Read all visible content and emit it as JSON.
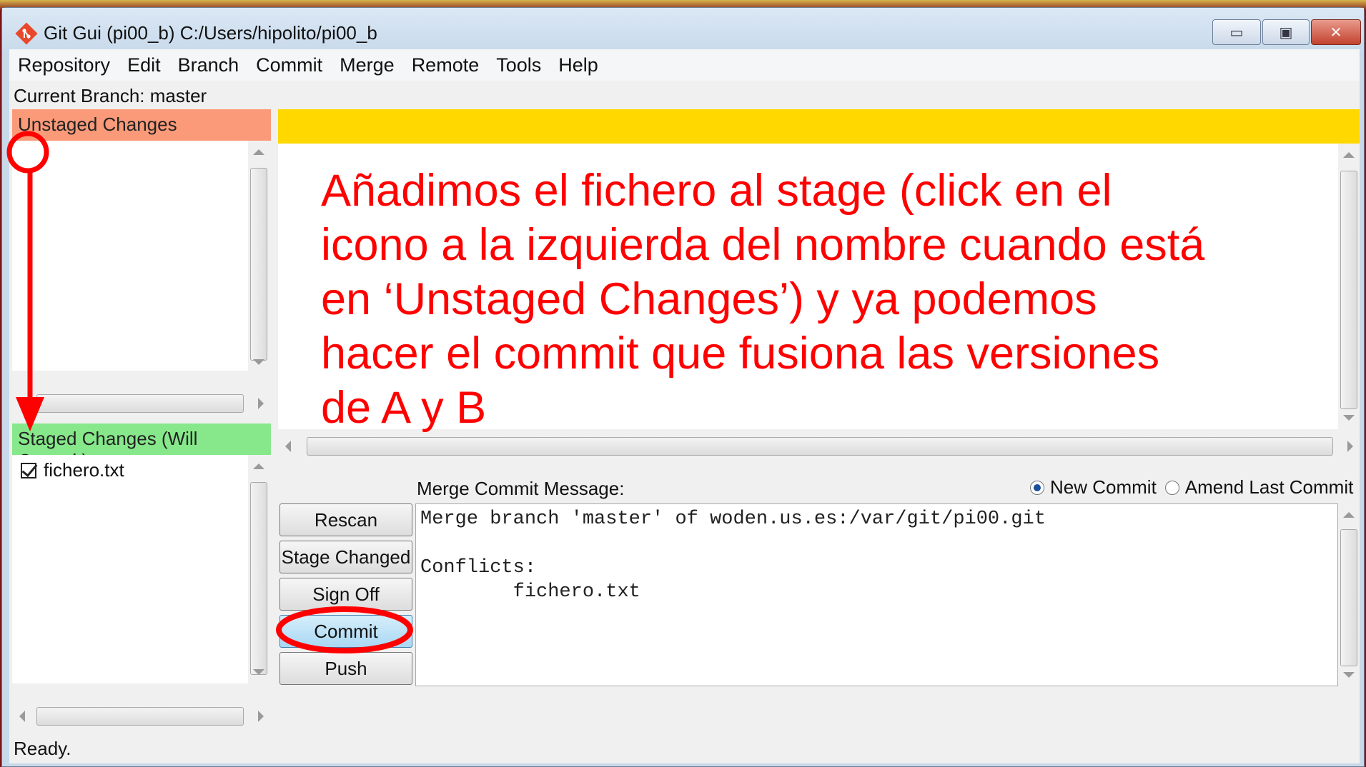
{
  "window": {
    "title": "Git Gui (pi00_b) C:/Users/hipolito/pi00_b",
    "minimize_glyph": "▭",
    "maximize_glyph": "▣",
    "close_glyph": "✕"
  },
  "menu": [
    "Repository",
    "Edit",
    "Branch",
    "Commit",
    "Merge",
    "Remote",
    "Tools",
    "Help"
  ],
  "branch_line": "Current Branch: master",
  "unstaged": {
    "header": "Unstaged Changes"
  },
  "staged": {
    "header": "Staged Changes (Will Commit)",
    "files": [
      "fichero.txt"
    ]
  },
  "annotation": "Añadimos el fichero al stage (click en el icono a la izquierda del nombre cuando está en ‘Unstaged Changes’) y ya podemos hacer el commit que fusiona las versiones de A y B",
  "commit": {
    "label": "Merge Commit Message:",
    "radio_new": "New Commit",
    "radio_amend": "Amend Last Commit",
    "message": "Merge branch 'master' of woden.us.es:/var/git/pi00.git\n\nConflicts:\n\tfichero.txt",
    "buttons": {
      "rescan": "Rescan",
      "stage_changed": "Stage Changed",
      "sign_off": "Sign Off",
      "commit": "Commit",
      "push": "Push"
    }
  },
  "status": "Ready.",
  "colors": {
    "unstaged_header": "#fa9a79",
    "staged_header": "#86e88a",
    "diff_header": "#ffd800",
    "annotation": "#ff0000"
  },
  "icons": {
    "app": "git-logo-icon",
    "checkbox": "checked-box-icon"
  }
}
